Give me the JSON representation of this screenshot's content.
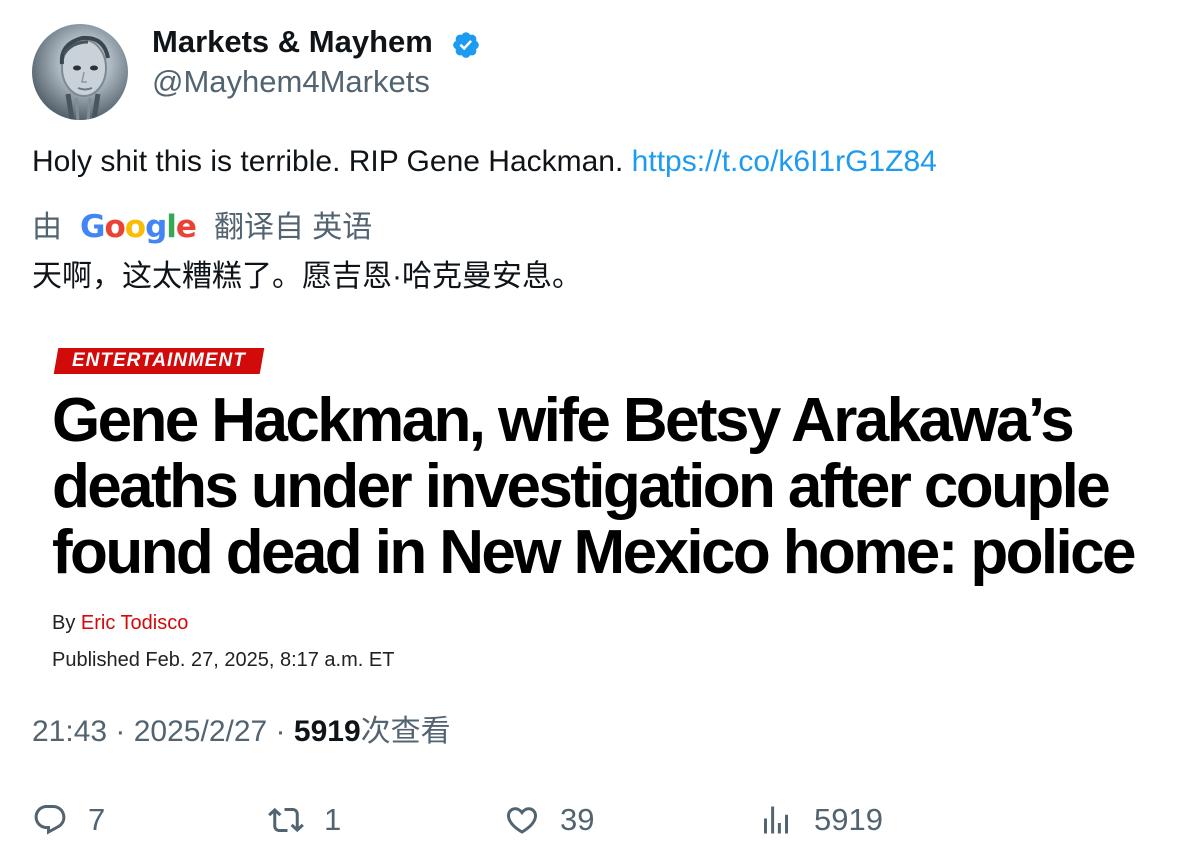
{
  "author": {
    "display_name": "Markets & Mayhem",
    "handle": "@Mayhem4Markets",
    "verified_icon": "verified-badge-icon",
    "verified_color": "#1d9bf0"
  },
  "tweet": {
    "text": "Holy shit this is terrible. RIP Gene Hackman.",
    "link": "https://t.co/k6I1rG1Z84"
  },
  "translation": {
    "prefix": "由",
    "provider": "Google",
    "suffix": "翻译自 英语",
    "text": "天啊，这太糟糕了。愿吉恩·哈克曼安息。"
  },
  "article": {
    "section": "ENTERTAINMENT",
    "headline": "Gene Hackman, wife Betsy Arakawa’s deaths under investigation after couple found dead in New Mexico home: police",
    "byline_prefix": "By",
    "author": "Eric Todisco",
    "published": "Published Feb. 27, 2025, 8:17 a.m. ET",
    "accent_color": "#d20a0a"
  },
  "meta": {
    "time": "21:43",
    "separator": " · ",
    "date": "2025/2/27",
    "views": "5919",
    "views_label": "次查看"
  },
  "actions": {
    "replies": "7",
    "retweets": "1",
    "likes": "39",
    "views": "5919"
  }
}
